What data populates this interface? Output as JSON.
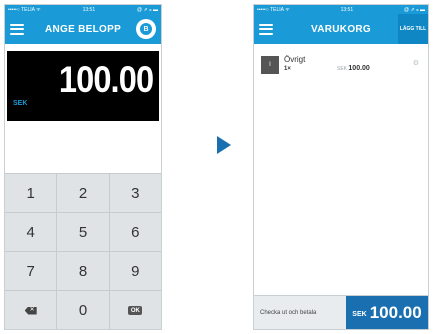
{
  "screen1": {
    "status": {
      "carrier": "•••••○ TELIA ᯤ",
      "time": "13:51",
      "right": "@ ⇗ ⁎ ▬"
    },
    "title": "ANGE BELOPP",
    "b_button": "B",
    "currency": "SEK",
    "amount": "100.00",
    "keys": [
      [
        "1",
        "2",
        "3"
      ],
      [
        "4",
        "5",
        "6"
      ],
      [
        "7",
        "8",
        "9"
      ]
    ],
    "zero": "0",
    "ok": "OK"
  },
  "screen2": {
    "status": {
      "carrier": "•••••○ TELIA ᯤ",
      "time": "13:51",
      "right": "@ ⇗ ⁎ ▬"
    },
    "title": "VARUKORG",
    "add_label": "LÄGG TILL",
    "item": {
      "name": "Övrigt",
      "qty": "1×",
      "currency": "SEK",
      "price": "100.00",
      "thumb": "I"
    },
    "footer_text": "Checka ut och betala",
    "total_currency": "SEK",
    "total": "100.00"
  },
  "accent": "#1a9bd7",
  "icons": [
    "menu-icon",
    "backspace-icon",
    "settings-gear-icon",
    "arrow-right-icon"
  ]
}
